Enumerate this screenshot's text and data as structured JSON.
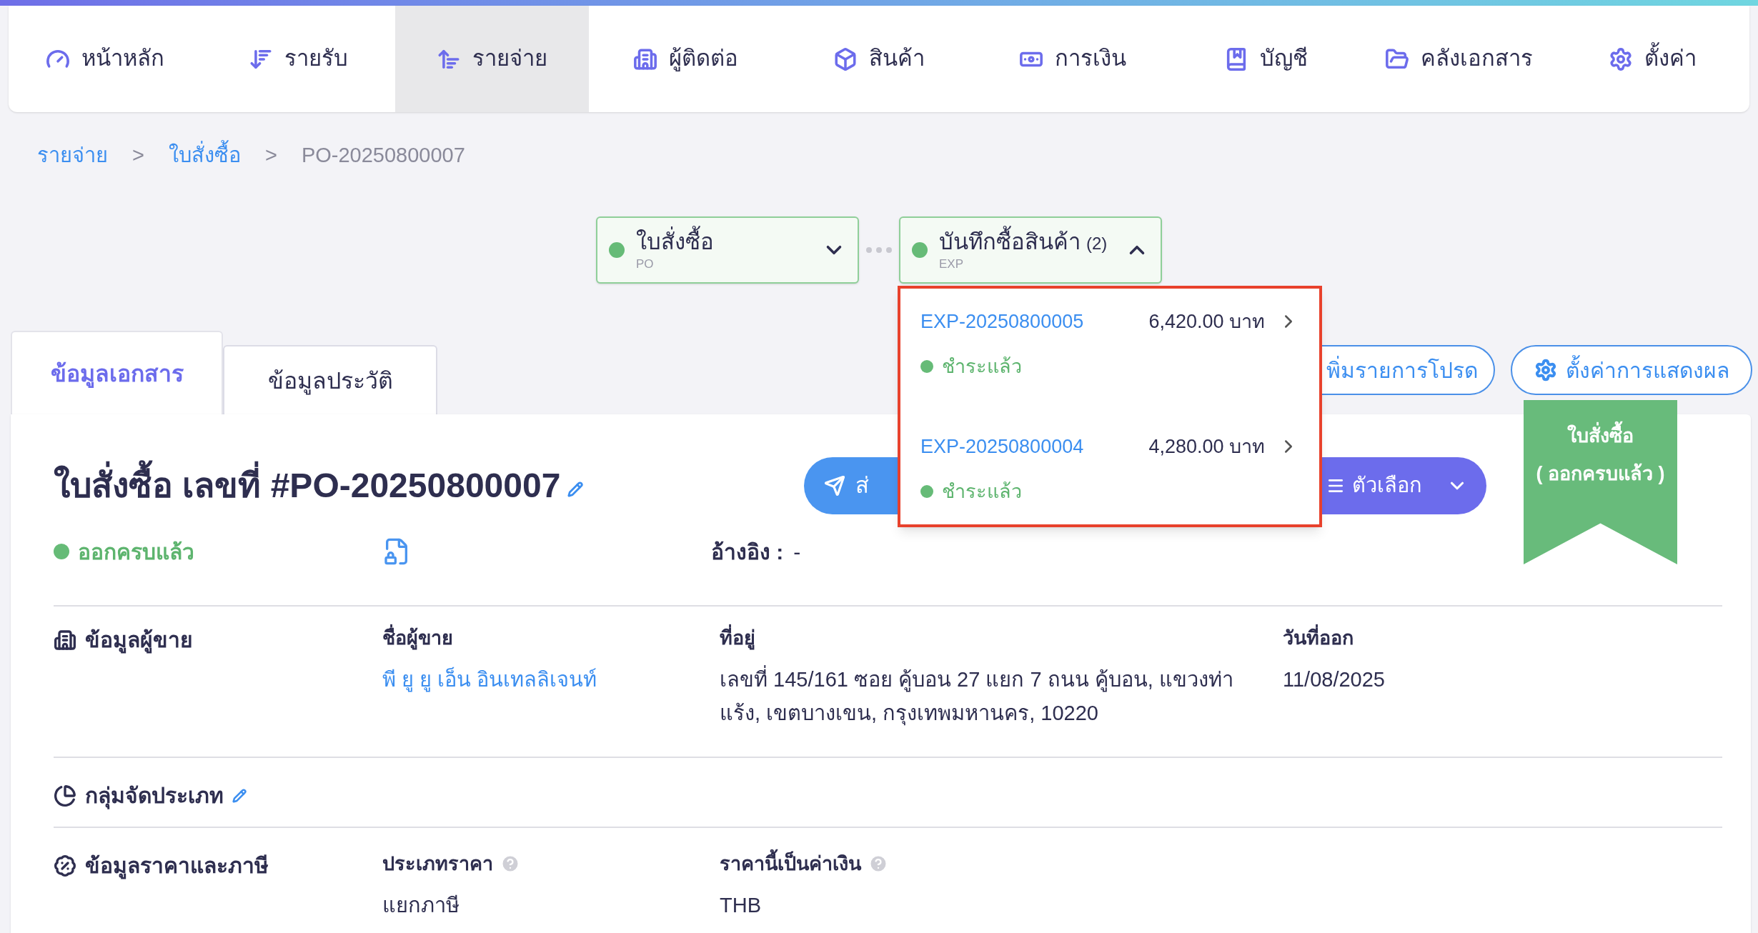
{
  "nav": {
    "items": [
      {
        "label": "หน้าหลัก",
        "selected": false
      },
      {
        "label": "รายรับ",
        "selected": false
      },
      {
        "label": "รายจ่าย",
        "selected": true
      },
      {
        "label": "ผู้ติดต่อ",
        "selected": false
      },
      {
        "label": "สินค้า",
        "selected": false
      },
      {
        "label": "การเงิน",
        "selected": false
      },
      {
        "label": "บัญชี",
        "selected": false
      },
      {
        "label": "คลังเอกสาร",
        "selected": false
      },
      {
        "label": "ตั้งค่า",
        "selected": false
      }
    ]
  },
  "breadcrumb": [
    {
      "label": "รายจ่าย",
      "kind": "link"
    },
    {
      "label": ">",
      "kind": "separator"
    },
    {
      "label": "ใบสั่งซื้อ",
      "kind": "link"
    },
    {
      "label": ">",
      "kind": "separator"
    },
    {
      "label": "PO-20250800007",
      "kind": "current"
    }
  ],
  "flow": {
    "steps": [
      {
        "title": "ใบสั่งซื้อ",
        "code": "PO",
        "color": "#66bb77",
        "expanded": false
      },
      {
        "title": "บันทึกซื้อสินค้า",
        "count": "(2)",
        "code": "EXP",
        "color": "#66bb77",
        "expanded": true
      }
    ],
    "dropdown": [
      {
        "id": "EXP-20250800005",
        "amount": "6,420.00 บาท",
        "status": "ชำระแล้ว",
        "color": "#66bb77"
      },
      {
        "id": "EXP-20250800004",
        "amount": "4,280.00 บาท",
        "status": "ชำระแล้ว",
        "color": "#66bb77"
      }
    ]
  },
  "tabs": [
    {
      "label": "ข้อมูลเอกสาร",
      "selected": true
    },
    {
      "label": "ข้อมูลประวัติ",
      "selected": false
    }
  ],
  "toolbar": {
    "favorite": "พิ่มรายการโปรด",
    "display_settings": "ตั้งค่าการแสดงผล"
  },
  "document": {
    "title": "ใบสั่งซื้อ เลขที่ #PO-20250800007",
    "send": "ส่",
    "options": "ตัวเลือก",
    "status": {
      "label": "ออกครบแล้ว",
      "color": "#66bb77"
    },
    "reference": {
      "label": "อ้างอิง :",
      "value": "-"
    },
    "ribbon": [
      "ใบสั่งซื้อ",
      "( ออกครบแล้ว )"
    ]
  },
  "sections": [
    {
      "kind": "vendor",
      "heading": "ข้อมูลผู้ขาย",
      "fields": [
        {
          "label": "ชื่อผู้ขาย",
          "value": "พี ยู ยู เอ็น อินเทลลิเจนท์",
          "kind": "link"
        },
        {
          "label": "ที่อยู่",
          "value": "เลขที่ 145/161 ซอย คู้บอน 27 แยก 7 ถนน คู้บอน, แขวงท่าแร้ง, เขตบางเขน, กรุงเทพมหานคร, 10220",
          "kind": "text"
        },
        {
          "label": "วันที่ออก",
          "value": "11/08/2025",
          "kind": "text"
        }
      ]
    },
    {
      "kind": "category",
      "heading": "กลุ่มจัดประเภท"
    },
    {
      "kind": "pricing",
      "heading": "ข้อมูลราคาและภาษี",
      "fields": [
        {
          "label": "ประเภทราคา",
          "value": "แยกภาษี",
          "kind": "help"
        },
        {
          "label": "ราคานี้เป็นค่าเงิน",
          "value": "THB",
          "kind": "help"
        }
      ]
    }
  ]
}
